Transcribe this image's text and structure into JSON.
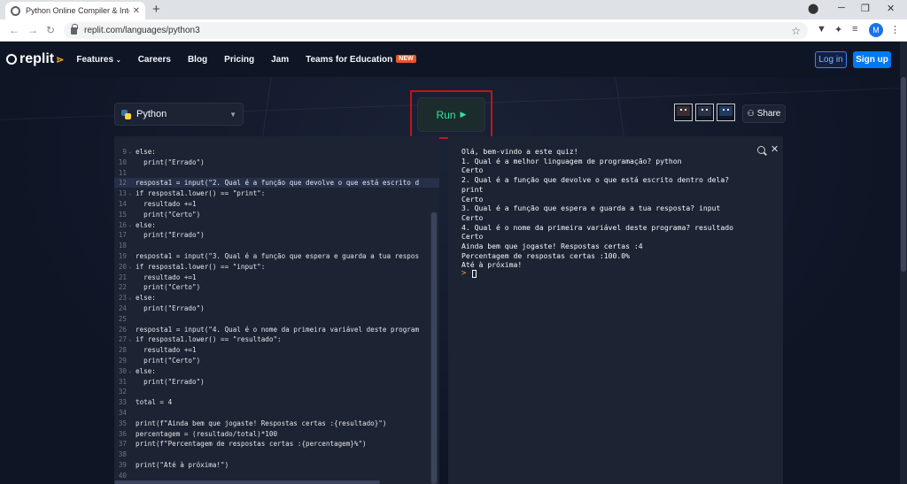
{
  "browser": {
    "tab_title": "Python Online Compiler & Interp",
    "url": "replit.com/languages/python3",
    "profile_initial": "M"
  },
  "nav": {
    "logo": "replit",
    "links": [
      "Features",
      "Careers",
      "Blog",
      "Pricing",
      "Jam",
      "Teams for Education"
    ],
    "new_badge": "NEW",
    "login": "Log in",
    "signup": "Sign up"
  },
  "toolbar": {
    "language": "Python",
    "run_label": "Run",
    "share_label": "Share"
  },
  "colors": {
    "background": "#0e1525",
    "panel": "#1c2333",
    "run_text": "#2ee5a0",
    "highlight_box": "#c0141b",
    "signup": "#0079f2"
  },
  "editor": {
    "lines": [
      {
        "n": "9",
        "fold": "⌄",
        "text": "else:"
      },
      {
        "n": "10",
        "text": "  print(\"Errado\")"
      },
      {
        "n": "11",
        "text": ""
      },
      {
        "n": "12",
        "text": "resposta1 = input(\"2. Qual é a função que devolve o que está escrito d",
        "hl": true
      },
      {
        "n": "13",
        "fold": "⌄",
        "text": "if resposta1.lower() == \"print\":"
      },
      {
        "n": "14",
        "text": "  resultado +=1"
      },
      {
        "n": "15",
        "text": "  print(\"Certo\")"
      },
      {
        "n": "16",
        "fold": "⌄",
        "text": "else:"
      },
      {
        "n": "17",
        "text": "  print(\"Errado\")"
      },
      {
        "n": "18",
        "text": ""
      },
      {
        "n": "19",
        "text": "resposta1 = input(\"3. Qual é a função que espera e guarda a tua respos"
      },
      {
        "n": "20",
        "fold": "⌄",
        "text": "if resposta1.lower() == \"input\":"
      },
      {
        "n": "21",
        "text": "  resultado +=1"
      },
      {
        "n": "22",
        "text": "  print(\"Certo\")"
      },
      {
        "n": "23",
        "fold": "⌄",
        "text": "else:"
      },
      {
        "n": "24",
        "text": "  print(\"Errado\")"
      },
      {
        "n": "25",
        "text": ""
      },
      {
        "n": "26",
        "text": "resposta1 = input(\"4. Qual é o nome da primeira variável deste program"
      },
      {
        "n": "27",
        "fold": "⌄",
        "text": "if resposta1.lower() == \"resultado\":"
      },
      {
        "n": "28",
        "text": "  resultado +=1"
      },
      {
        "n": "29",
        "text": "  print(\"Certo\")"
      },
      {
        "n": "30",
        "fold": "⌄",
        "text": "else:"
      },
      {
        "n": "31",
        "text": "  print(\"Errado\")"
      },
      {
        "n": "32",
        "text": ""
      },
      {
        "n": "33",
        "text": "total = 4"
      },
      {
        "n": "34",
        "text": ""
      },
      {
        "n": "35",
        "text": "print(f\"Ainda bem que jogaste! Respostas certas :{resultado}\")"
      },
      {
        "n": "36",
        "text": "percentagem = (resultado/total)*100"
      },
      {
        "n": "37",
        "text": "print(f\"Percentagem de respostas certas :{percentagem}%\")"
      },
      {
        "n": "38",
        "text": ""
      },
      {
        "n": "39",
        "text": "print(\"Até à próxima!\")"
      },
      {
        "n": "40",
        "text": ""
      }
    ]
  },
  "console": {
    "lines": [
      "Olá, bem-vindo a este quiz!",
      "1. Qual é a melhor linguagem de programação? python",
      "Certo",
      "2. Qual é a função que devolve o que está escrito dentro dela?",
      "print",
      "Certo",
      "3. Qual é a função que espera e guarda a tua resposta? input",
      "Certo",
      "4. Qual é o nome da primeira variável deste programa? resultado",
      "Certo",
      "Ainda bem que jogaste! Respostas certas :4",
      "Percentagem de respostas certas :100.0%",
      "Até à próxima!"
    ],
    "prompt": ">"
  }
}
